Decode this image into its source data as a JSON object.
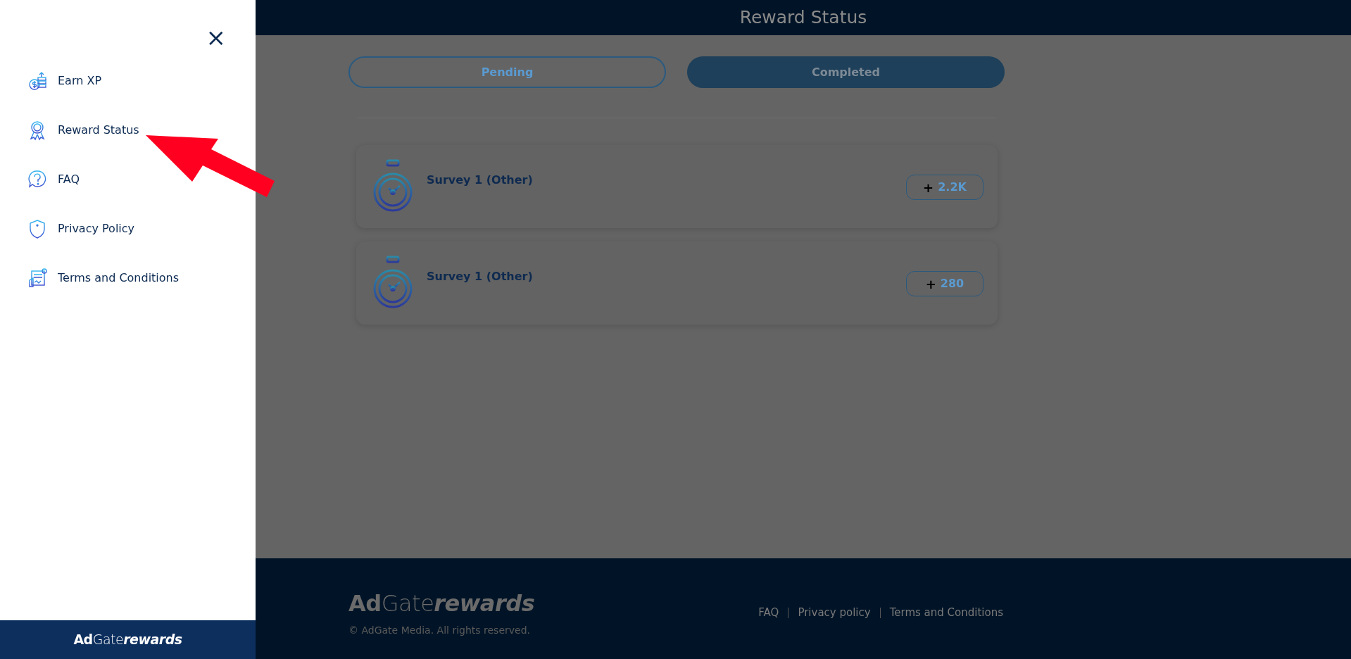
{
  "sidebar": {
    "close": "×",
    "items": [
      {
        "label": "Earn XP",
        "selected": false
      },
      {
        "label": "Reward Status",
        "selected": false
      },
      {
        "label": "FAQ",
        "selected": false
      },
      {
        "label": "Privacy Policy",
        "selected": false
      },
      {
        "label": "Terms and Conditions",
        "selected": false
      }
    ],
    "logo": [
      "Ad",
      "Gate",
      "rewards"
    ]
  },
  "header": {
    "title": "Reward Status"
  },
  "tabs": [
    {
      "label": "Pending",
      "selected": false
    },
    {
      "label": "Completed",
      "selected": true
    }
  ],
  "rewards": [
    {
      "title": "Survey 1 (Other)",
      "sign": "+",
      "amount": "2.2K"
    },
    {
      "title": "Survey 1 (Other)",
      "sign": "+",
      "amount": "280"
    }
  ],
  "footer": {
    "logo": [
      "Ad",
      "Gate",
      "rewards"
    ],
    "copyright": "© AdGate Media. All rights reserved.",
    "links": [
      "FAQ",
      "Privacy policy",
      "Terms and Conditions"
    ]
  }
}
